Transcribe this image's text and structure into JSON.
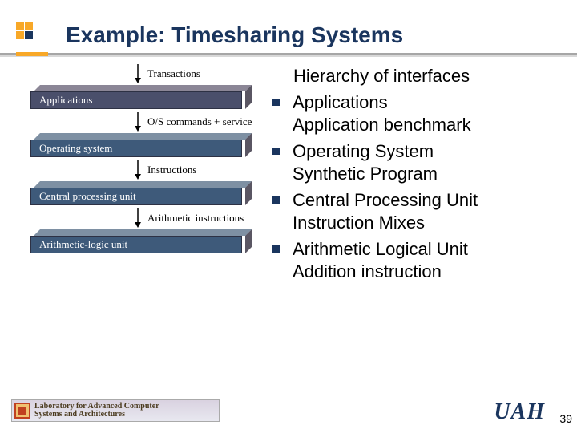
{
  "title": "Example: Timesharing Systems",
  "diagram": {
    "arrows": {
      "transactions": "Transactions",
      "os_commands": "O/S commands + service",
      "instructions": "Instructions",
      "arithmetic": "Arithmetic instructions"
    },
    "layers": {
      "applications": "Applications",
      "os": "Operating system",
      "cpu": "Central processing unit",
      "alu": "Arithmetic-logic unit"
    }
  },
  "bullets": {
    "heading": "Hierarchy of interfaces",
    "items": [
      {
        "line1": "Applications",
        "line2": "Application benchmark"
      },
      {
        "line1": "Operating System",
        "line2": "Synthetic Program"
      },
      {
        "line1": "Central Processing Unit",
        "line2": "Instruction Mixes"
      },
      {
        "line1": "Arithmetic Logical Unit",
        "line2": "Addition instruction"
      }
    ]
  },
  "footer": {
    "lab_line1": "Laboratory for Advanced Computer",
    "lab_line2": "Systems and Architectures",
    "uah": "UAH",
    "page": "39"
  }
}
